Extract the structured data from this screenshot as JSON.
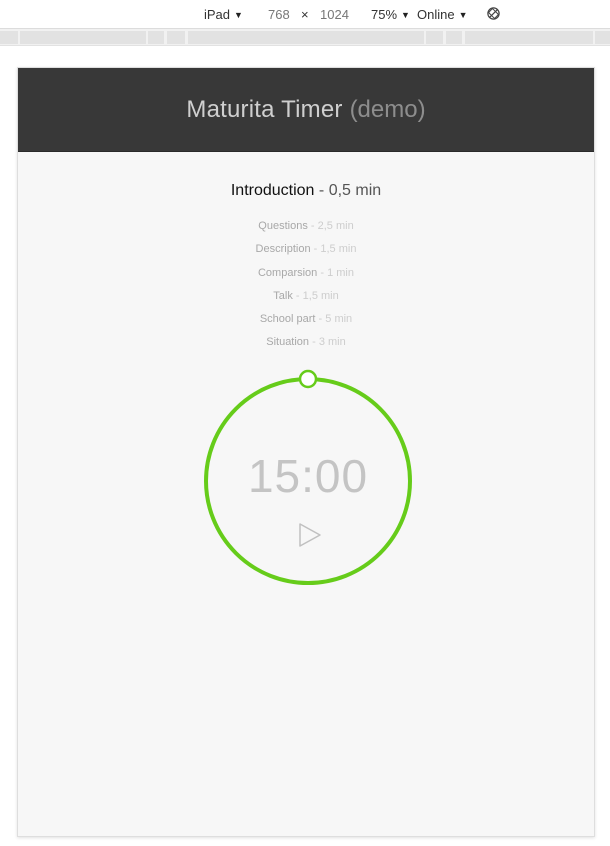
{
  "devtools": {
    "device": "iPad",
    "width": "768",
    "times": "×",
    "height": "1024",
    "zoom": "75%",
    "network": "Online",
    "rotate_icon": "rotate-icon"
  },
  "app": {
    "title": "Maturita Timer",
    "subtitle": "(demo)"
  },
  "current_section": {
    "name": "Introduction",
    "separator": "-",
    "duration": "0,5 min"
  },
  "sections": [
    {
      "name": "Questions",
      "separator": "-",
      "duration": "2,5 min"
    },
    {
      "name": "Description",
      "separator": "-",
      "duration": "1,5 min"
    },
    {
      "name": "Comparsion",
      "separator": "-",
      "duration": "1 min"
    },
    {
      "name": "Talk",
      "separator": "-",
      "duration": "1,5 min"
    },
    {
      "name": "School part",
      "separator": "-",
      "duration": "5 min"
    },
    {
      "name": "Situation",
      "separator": "-",
      "duration": "3 min"
    }
  ],
  "timer": {
    "display": "15:00",
    "progress": 0,
    "ring_color": "#66cc1a",
    "play_icon": "play-icon"
  }
}
